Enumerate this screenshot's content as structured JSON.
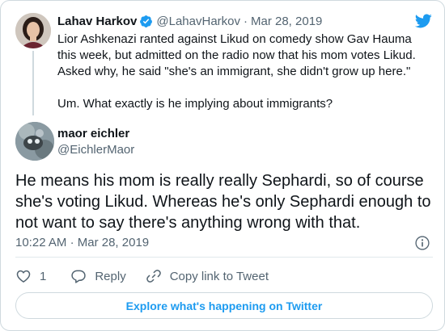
{
  "colors": {
    "brand_blue": "#1d9bf0",
    "text_primary": "#0f1419",
    "text_secondary": "#536471",
    "border": "#cfd9de"
  },
  "parent_tweet": {
    "author_name": "Lahav Harkov",
    "verified_icon": "verified-badge-icon",
    "handle": "@LahavHarkov",
    "separator": "·",
    "date": "Mar 28, 2019",
    "text_paragraph_1": "Lior Ashkenazi ranted against Likud on comedy show Gav Hauma this week, but admitted on the radio now that his mom votes Likud. Asked why, he said \"she's an immigrant, she didn't grow up here.\"",
    "text_paragraph_2": "Um. What exactly is he implying about immigrants?"
  },
  "main_tweet": {
    "author_name": "maor eichler",
    "handle": "@EichlerMaor",
    "text": "He means his mom is really really Sephardi, so of course she's voting Likud. Whereas he's only Sephardi enough to not want to say there's anything wrong with that.",
    "time": "10:22 AM",
    "separator": "·",
    "date": "Mar 28, 2019",
    "info_icon": "info-icon"
  },
  "actions": {
    "like_icon": "heart-icon",
    "like_count": "1",
    "reply_icon": "reply-icon",
    "reply_label": "Reply",
    "copy_link_icon": "link-icon",
    "copy_link_label": "Copy link to Tweet"
  },
  "footer": {
    "explore_label": "Explore what's happening on Twitter"
  },
  "header_icon": "twitter-bird-icon"
}
